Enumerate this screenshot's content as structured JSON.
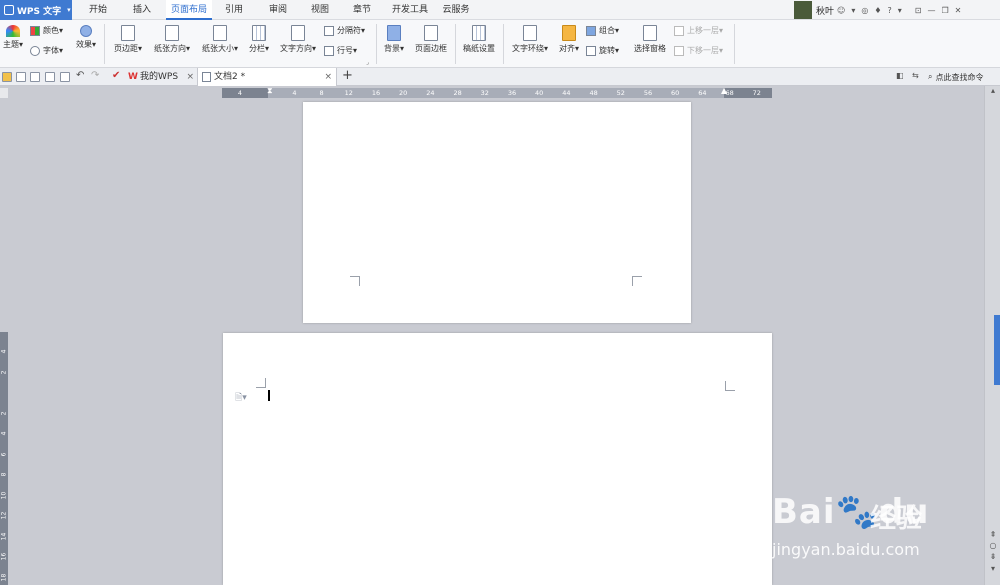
{
  "app": {
    "title": "WPS 文字"
  },
  "menu": {
    "tabs": [
      "开始",
      "插入",
      "页面布局",
      "引用",
      "审阅",
      "视图",
      "章节",
      "开发工具",
      "云服务"
    ],
    "active_index": 2
  },
  "user": {
    "name": "秋叶"
  },
  "ribbon": {
    "theme": "主题",
    "color": "颜色",
    "font": "字体",
    "effect": "效果",
    "margins": "页边距",
    "orientation": "纸张方向",
    "size": "纸张大小",
    "columns": "分栏",
    "text_direction": "文字方向",
    "breaks": "分隔符",
    "line_numbers": "行号",
    "background": "背景",
    "page_border": "页面边框",
    "grid_paper": "稿纸设置",
    "wrap_text": "文字环绕",
    "align": "对齐",
    "rotate": "旋转",
    "group": "组合",
    "selection_pane": "选择窗格",
    "bring_forward": "上移一层",
    "send_backward": "下移一层"
  },
  "tabs": {
    "my_wps": "我的WPS",
    "document": "文档2 *",
    "add": "+"
  },
  "search": {
    "label": "点此查找命令"
  },
  "ruler": {
    "h_ticks": [
      "4",
      "",
      "4",
      "8",
      "12",
      "16",
      "20",
      "24",
      "28",
      "32",
      "36",
      "40",
      "44",
      "48",
      "52",
      "56",
      "60",
      "64",
      "68",
      "72"
    ],
    "v_ticks": [
      "4",
      "2",
      "",
      "2",
      "4",
      "6",
      "8",
      "10",
      "12",
      "14",
      "16",
      "18"
    ]
  },
  "watermark": {
    "brand": "Bai",
    "brand2": "du",
    "cn": "经验",
    "url": "jingyan.baidu.com"
  },
  "colors": {
    "accent": "#3f7ad1",
    "workspace": "#c9cbd2"
  }
}
